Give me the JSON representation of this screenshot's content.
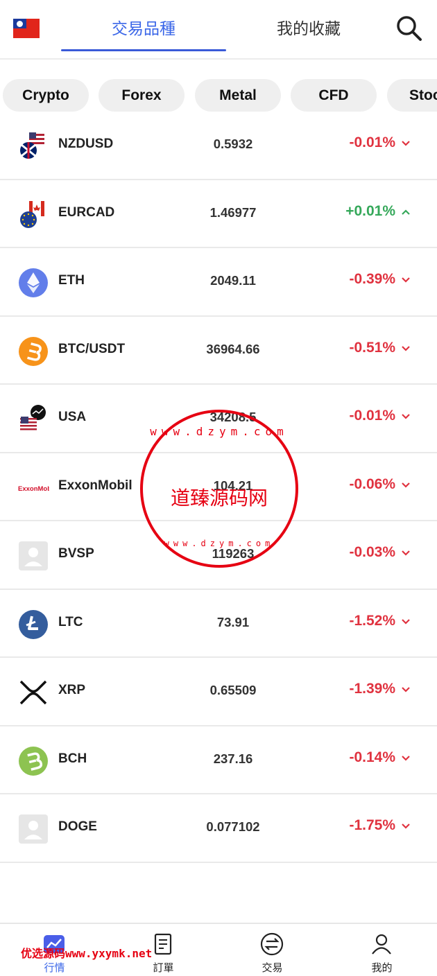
{
  "header": {
    "tabs": [
      {
        "label": "交易品種",
        "active": true
      },
      {
        "label": "我的收藏",
        "active": false
      }
    ],
    "flag_icon": "taiwan-flag-icon",
    "search_icon": "search-icon"
  },
  "categories": [
    "Crypto",
    "Forex",
    "Metal",
    "CFD",
    "Stock"
  ],
  "quotes": [
    {
      "name": "NZDUSD",
      "price": "0.5932",
      "change": "-0.01%",
      "direction": "down",
      "icon": "nzd-usd-flags-icon"
    },
    {
      "name": "EURCAD",
      "price": "1.46977",
      "change": "+0.01%",
      "direction": "up",
      "icon": "eur-cad-flags-icon"
    },
    {
      "name": "ETH",
      "price": "2049.11",
      "change": "-0.39%",
      "direction": "down",
      "icon": "ethereum-icon"
    },
    {
      "name": "BTC/USDT",
      "price": "36964.66",
      "change": "-0.51%",
      "direction": "down",
      "icon": "bitcoin-icon"
    },
    {
      "name": "USA",
      "price": "34208.5",
      "change": "-0.01%",
      "direction": "down",
      "icon": "usa-index-icon"
    },
    {
      "name": "ExxonMobil",
      "price": "104.21",
      "change": "-0.06%",
      "direction": "down",
      "icon": "exxonmobil-logo-icon"
    },
    {
      "name": "BVSP",
      "price": "119263",
      "change": "-0.03%",
      "direction": "down",
      "icon": "placeholder-avatar-icon"
    },
    {
      "name": "LTC",
      "price": "73.91",
      "change": "-1.52%",
      "direction": "down",
      "icon": "litecoin-icon"
    },
    {
      "name": "XRP",
      "price": "0.65509",
      "change": "-1.39%",
      "direction": "down",
      "icon": "xrp-icon"
    },
    {
      "name": "BCH",
      "price": "237.16",
      "change": "-0.14%",
      "direction": "down",
      "icon": "bitcoin-cash-icon"
    },
    {
      "name": "DOGE",
      "price": "0.077102",
      "change": "-1.75%",
      "direction": "down",
      "icon": "placeholder-avatar-icon"
    }
  ],
  "bottom_nav": [
    {
      "label": "行情",
      "icon": "chart-icon",
      "active": true
    },
    {
      "label": "訂單",
      "icon": "document-icon",
      "active": false
    },
    {
      "label": "交易",
      "icon": "exchange-icon",
      "active": false
    },
    {
      "label": "我的",
      "icon": "user-icon",
      "active": false
    }
  ],
  "overlays": {
    "stamp_text": "道臻源码网",
    "stamp_url": "www.dzym.com",
    "watermark": "优选源码www.yxymk.net"
  },
  "colors": {
    "accent": "#3a66e8",
    "down": "#e0323f",
    "up": "#35a85a"
  }
}
